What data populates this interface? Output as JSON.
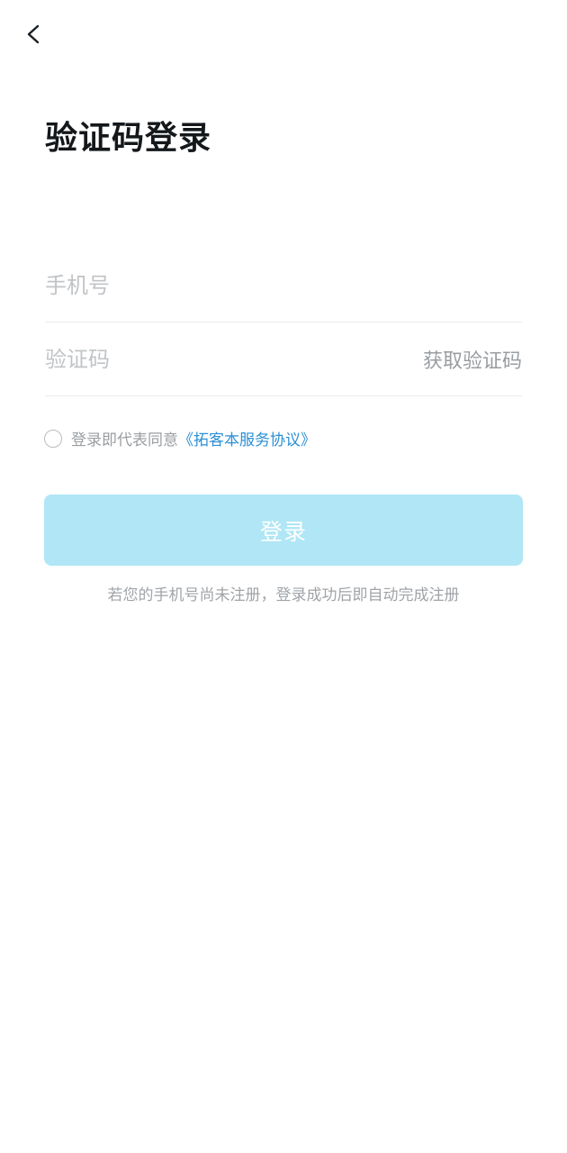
{
  "header": {
    "back_icon": "chevron-left-icon",
    "title": "验证码登录"
  },
  "form": {
    "phone_placeholder": "手机号",
    "phone_value": "",
    "code_placeholder": "验证码",
    "code_value": "",
    "get_code_label": "获取验证码"
  },
  "agreement": {
    "checked": false,
    "text": "登录即代表同意",
    "link_text": "《拓客本服务协议》",
    "link_color": "#2a8fd4"
  },
  "login": {
    "button_label": "登录",
    "button_color": "#b0e6f5",
    "hint": "若您的手机号尚未注册，登录成功后即自动完成注册"
  }
}
